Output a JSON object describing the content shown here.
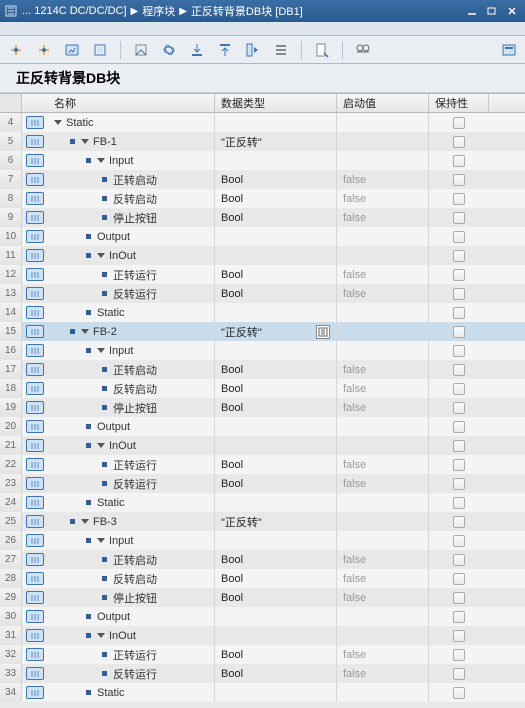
{
  "titlebar": {
    "breadcrumbs": [
      "... 1214C DC/DC/DC]",
      "程序块",
      "正反转背景DB块 [DB1]"
    ]
  },
  "block_title": "正反转背景DB块",
  "columns": {
    "name": "名称",
    "type": "数据类型",
    "start": "启动值",
    "keep": "保持性"
  },
  "rows": [
    {
      "n": 4,
      "tag": true,
      "indent": 0,
      "arrow": true,
      "bullet": false,
      "name": "Static",
      "type": "",
      "start": "",
      "sel": false
    },
    {
      "n": 5,
      "tag": true,
      "indent": 1,
      "arrow": true,
      "bullet": true,
      "name": "FB-1",
      "type": "\"正反转\"",
      "start": "",
      "sel": false
    },
    {
      "n": 6,
      "tag": true,
      "indent": 2,
      "arrow": true,
      "bullet": true,
      "name": "Input",
      "type": "",
      "start": "",
      "sel": false
    },
    {
      "n": 7,
      "tag": true,
      "indent": 3,
      "arrow": false,
      "bullet": true,
      "name": "正转启动",
      "type": "Bool",
      "start": "false",
      "sel": false
    },
    {
      "n": 8,
      "tag": true,
      "indent": 3,
      "arrow": false,
      "bullet": true,
      "name": "反转启动",
      "type": "Bool",
      "start": "false",
      "sel": false
    },
    {
      "n": 9,
      "tag": true,
      "indent": 3,
      "arrow": false,
      "bullet": true,
      "name": "停止按钮",
      "type": "Bool",
      "start": "false",
      "sel": false
    },
    {
      "n": 10,
      "tag": true,
      "indent": 2,
      "arrow": false,
      "bullet": true,
      "name": "Output",
      "type": "",
      "start": "",
      "sel": false
    },
    {
      "n": 11,
      "tag": true,
      "indent": 2,
      "arrow": true,
      "bullet": true,
      "name": "InOut",
      "type": "",
      "start": "",
      "sel": false
    },
    {
      "n": 12,
      "tag": true,
      "indent": 3,
      "arrow": false,
      "bullet": true,
      "name": "正转运行",
      "type": "Bool",
      "start": "false",
      "sel": false
    },
    {
      "n": 13,
      "tag": true,
      "indent": 3,
      "arrow": false,
      "bullet": true,
      "name": "反转运行",
      "type": "Bool",
      "start": "false",
      "sel": false
    },
    {
      "n": 14,
      "tag": true,
      "indent": 2,
      "arrow": false,
      "bullet": true,
      "name": "Static",
      "type": "",
      "start": "",
      "sel": false
    },
    {
      "n": 15,
      "tag": true,
      "indent": 1,
      "arrow": true,
      "bullet": true,
      "name": "FB-2",
      "type": "\"正反转\"",
      "start": "",
      "sel": true,
      "picker": true
    },
    {
      "n": 16,
      "tag": true,
      "indent": 2,
      "arrow": true,
      "bullet": true,
      "name": "Input",
      "type": "",
      "start": "",
      "sel": false
    },
    {
      "n": 17,
      "tag": true,
      "indent": 3,
      "arrow": false,
      "bullet": true,
      "name": "正转启动",
      "type": "Bool",
      "start": "false",
      "sel": false
    },
    {
      "n": 18,
      "tag": true,
      "indent": 3,
      "arrow": false,
      "bullet": true,
      "name": "反转启动",
      "type": "Bool",
      "start": "false",
      "sel": false
    },
    {
      "n": 19,
      "tag": true,
      "indent": 3,
      "arrow": false,
      "bullet": true,
      "name": "停止按钮",
      "type": "Bool",
      "start": "false",
      "sel": false
    },
    {
      "n": 20,
      "tag": true,
      "indent": 2,
      "arrow": false,
      "bullet": true,
      "name": "Output",
      "type": "",
      "start": "",
      "sel": false
    },
    {
      "n": 21,
      "tag": true,
      "indent": 2,
      "arrow": true,
      "bullet": true,
      "name": "InOut",
      "type": "",
      "start": "",
      "sel": false
    },
    {
      "n": 22,
      "tag": true,
      "indent": 3,
      "arrow": false,
      "bullet": true,
      "name": "正转运行",
      "type": "Bool",
      "start": "false",
      "sel": false
    },
    {
      "n": 23,
      "tag": true,
      "indent": 3,
      "arrow": false,
      "bullet": true,
      "name": "反转运行",
      "type": "Bool",
      "start": "false",
      "sel": false
    },
    {
      "n": 24,
      "tag": true,
      "indent": 2,
      "arrow": false,
      "bullet": true,
      "name": "Static",
      "type": "",
      "start": "",
      "sel": false
    },
    {
      "n": 25,
      "tag": true,
      "indent": 1,
      "arrow": true,
      "bullet": true,
      "name": "FB-3",
      "type": "\"正反转\"",
      "start": "",
      "sel": false
    },
    {
      "n": 26,
      "tag": true,
      "indent": 2,
      "arrow": true,
      "bullet": true,
      "name": "Input",
      "type": "",
      "start": "",
      "sel": false
    },
    {
      "n": 27,
      "tag": true,
      "indent": 3,
      "arrow": false,
      "bullet": true,
      "name": "正转启动",
      "type": "Bool",
      "start": "false",
      "sel": false
    },
    {
      "n": 28,
      "tag": true,
      "indent": 3,
      "arrow": false,
      "bullet": true,
      "name": "反转启动",
      "type": "Bool",
      "start": "false",
      "sel": false
    },
    {
      "n": 29,
      "tag": true,
      "indent": 3,
      "arrow": false,
      "bullet": true,
      "name": "停止按钮",
      "type": "Bool",
      "start": "false",
      "sel": false
    },
    {
      "n": 30,
      "tag": true,
      "indent": 2,
      "arrow": false,
      "bullet": true,
      "name": "Output",
      "type": "",
      "start": "",
      "sel": false
    },
    {
      "n": 31,
      "tag": true,
      "indent": 2,
      "arrow": true,
      "bullet": true,
      "name": "InOut",
      "type": "",
      "start": "",
      "sel": false
    },
    {
      "n": 32,
      "tag": true,
      "indent": 3,
      "arrow": false,
      "bullet": true,
      "name": "正转运行",
      "type": "Bool",
      "start": "false",
      "sel": false
    },
    {
      "n": 33,
      "tag": true,
      "indent": 3,
      "arrow": false,
      "bullet": true,
      "name": "反转运行",
      "type": "Bool",
      "start": "false",
      "sel": false
    },
    {
      "n": 34,
      "tag": true,
      "indent": 2,
      "arrow": false,
      "bullet": true,
      "name": "Static",
      "type": "",
      "start": "",
      "sel": false
    }
  ]
}
